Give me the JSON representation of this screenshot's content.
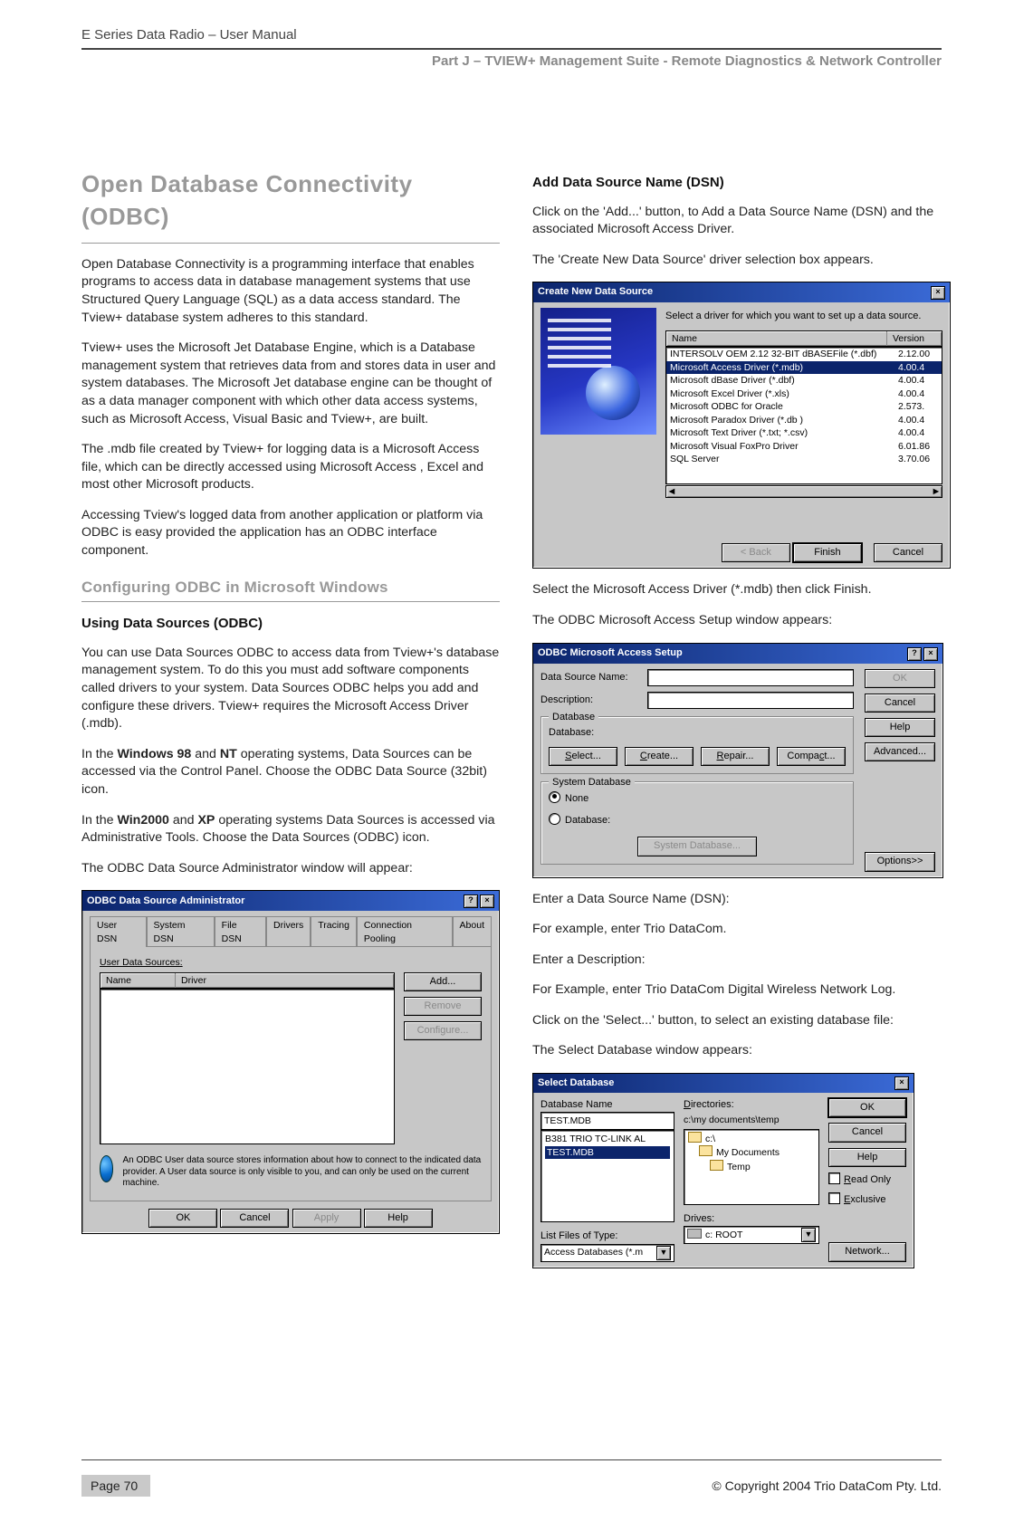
{
  "header": "E Series Data Radio – User Manual",
  "part_line": "Part J – TVIEW+ Management Suite -  Remote Diagnostics & Network Controller",
  "left": {
    "h1": "Open Database Connectivity (ODBC)",
    "p1": "Open Database Connectivity is a programming interface that enables programs to access data in database management systems that use Structured Query Language (SQL) as a data access standard.  The Tview+ database system adheres to this standard.",
    "p2": "Tview+ uses the Microsoft Jet Database Engine, which is a Database management system that retrieves data from and stores data in user and system databases. The Microsoft Jet database engine can be thought of as a data manager component with which other data access systems, such as Microsoft Access, Visual Basic and Tview+, are built.",
    "p3": "The .mdb file created by Tview+ for logging data is a Microsoft Access file, which can be directly accessed using Microsoft Access , Excel and most other Microsoft products.",
    "p4": "Accessing Tview's logged data from another application or platform via ODBC is easy provided the application has an ODBC interface component.",
    "h2": "Configuring ODBC in Microsoft Windows",
    "h3": "Using Data Sources (ODBC)",
    "p5": "You can use Data Sources ODBC to access data from Tview+'s database management system.  To do this you must add software components called drivers to your system. Data Sources ODBC helps you add and configure these drivers.  Tview+ requires the Microsoft Access Driver (.mdb).",
    "p6a": "In the ",
    "p6b": "Windows 98",
    "p6c": " and ",
    "p6d": "NT",
    "p6e": " operating systems, Data Sources can be accessed via the Control Panel.  Choose the ODBC Data Source (32bit) icon.",
    "p7a": "In the ",
    "p7b": "Win2000",
    "p7c": " and ",
    "p7d": "XP",
    "p7e": " operating systems Data Sources is accessed via Administrative Tools.  Choose the Data Sources (ODBC) icon.",
    "p8": "The ODBC Data Source Administrator window will appear:"
  },
  "right": {
    "h3": "Add Data Source Name (DSN)",
    "p1": "Click on the 'Add...' button, to Add a Data Source Name (DSN) and the associated Microsoft Access Driver.",
    "p2": "The 'Create New Data Source' driver selection box appears.",
    "p3": "Select the Microsoft Access Driver (*.mdb) then click Finish.",
    "p4": "The ODBC Microsoft Access Setup window appears:",
    "p5": "Enter a Data Source Name (DSN):",
    "p6": "For example, enter Trio DataCom.",
    "p7": "Enter a Description:",
    "p8": "For Example, enter Trio DataCom Digital Wireless Network Log.",
    "p9": "Click on the 'Select...' button, to select an existing database file:",
    "p10": "The Select Database window appears:"
  },
  "dlg1": {
    "title": "ODBC Data Source Administrator",
    "tabs": [
      "User DSN",
      "System DSN",
      "File DSN",
      "Drivers",
      "Tracing",
      "Connection Pooling",
      "About"
    ],
    "label_uds": "User Data Sources:",
    "cols": [
      "Name",
      "Driver"
    ],
    "btn_add": "Add...",
    "btn_remove": "Remove",
    "btn_conf": "Configure...",
    "info": "An ODBC User data source stores information about how to connect to the indicated data provider.  A User data source is only visible to you, and can only be used on the current machine.",
    "ok": "OK",
    "cancel": "Cancel",
    "apply": "Apply",
    "help": "Help"
  },
  "dlg2": {
    "title": "Create New Data Source",
    "prompt": "Select a driver for which you want to set up a data source.",
    "col_name": "Name",
    "col_ver": "Version",
    "rows": [
      {
        "n": "INTERSOLV OEM 2.12 32-BIT dBASEFile (*.dbf)",
        "v": "2.12.00"
      },
      {
        "n": "Microsoft Access Driver (*.mdb)",
        "v": "4.00.4"
      },
      {
        "n": "Microsoft dBase Driver (*.dbf)",
        "v": "4.00.4"
      },
      {
        "n": "Microsoft Excel Driver (*.xls)",
        "v": "4.00.4"
      },
      {
        "n": "Microsoft ODBC for Oracle",
        "v": "2.573."
      },
      {
        "n": "Microsoft Paradox Driver (*.db )",
        "v": "4.00.4"
      },
      {
        "n": "Microsoft Text Driver (*.txt; *.csv)",
        "v": "4.00.4"
      },
      {
        "n": "Microsoft Visual FoxPro Driver",
        "v": "6.01.86"
      },
      {
        "n": "SQL Server",
        "v": "3.70.06"
      }
    ],
    "selected_index": 1,
    "back": "< Back",
    "finish": "Finish",
    "cancel": "Cancel"
  },
  "dlg3": {
    "title": "ODBC Microsoft Access Setup",
    "lbl_dsn": "Data Source Name:",
    "lbl_desc": "Description:",
    "grp_db": "Database",
    "lbl_db": "Database:",
    "btn_select": "Select...",
    "btn_create": "Create...",
    "btn_repair": "Repair...",
    "btn_compact": "Compact...",
    "grp_sys": "System Database",
    "r_none": "None",
    "r_db": "Database:",
    "btn_sysdb": "System Database...",
    "ok": "OK",
    "cancel": "Cancel",
    "help": "Help",
    "advanced": "Advanced...",
    "options": "Options>>"
  },
  "dlg4": {
    "title": "Select Database",
    "lbl_dbname": "Database Name",
    "val_dbname": "TEST.MDB",
    "files": [
      "B381 TRIO TC-LINK AL",
      "TEST.MDB"
    ],
    "sel_file_index": 1,
    "lbl_dirs": "Directories:",
    "cur_dir": "c:\\my documents\\temp",
    "dirs": [
      "c:\\",
      "My Documents",
      "Temp"
    ],
    "lbl_listtype": "List Files of Type:",
    "val_listtype": "Access Databases (*.m",
    "lbl_drives": "Drives:",
    "val_drive": "c: ROOT",
    "ok": "OK",
    "cancel": "Cancel",
    "help": "Help",
    "readonly": "Read Only",
    "exclusive": "Exclusive",
    "network": "Network..."
  },
  "footer": {
    "page": "Page 70",
    "copy": "© Copyright 2004 Trio DataCom Pty. Ltd."
  }
}
